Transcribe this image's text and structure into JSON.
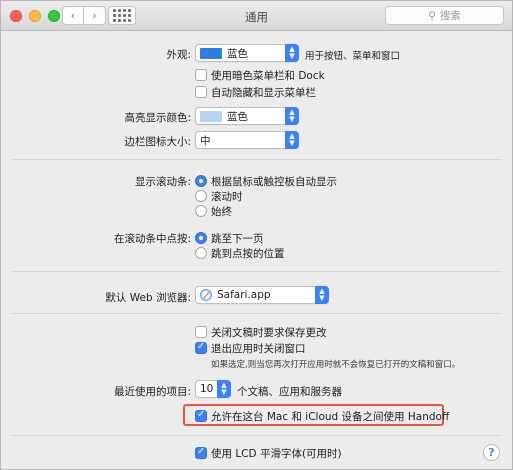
{
  "window": {
    "title": "通用"
  },
  "search": {
    "placeholder": "搜索"
  },
  "appearance": {
    "label": "外观:",
    "value": "蓝色",
    "swatch_color": "#2f7fe3",
    "note": "用于按钮、菜单和窗口",
    "dark_menu": "使用暗色菜单栏和 Dock",
    "auto_hide_menu": "自动隐藏和显示菜单栏"
  },
  "highlight": {
    "label": "高亮显示颜色:",
    "value": "蓝色",
    "swatch_color": "#b5d3f3"
  },
  "sidebar_icon": {
    "label": "边栏图标大小:",
    "value": "中"
  },
  "scrollbars": {
    "label": "显示滚动条:",
    "options": [
      "根据鼠标或触控板自动显示",
      "滚动时",
      "始终"
    ]
  },
  "click_scroll": {
    "label": "在滚动条中点按:",
    "options": [
      "跳至下一页",
      "跳到点按的位置"
    ]
  },
  "browser": {
    "label": "默认 Web 浏览器:",
    "value": "Safari.app"
  },
  "documents": {
    "ask_save": "关闭文稿时要求保存更改",
    "close_windows": "退出应用时关闭窗口",
    "note": "如果选定,则当您再次打开应用时就不会恢复已打开的文稿和窗口。"
  },
  "recent": {
    "label": "最近使用的项目:",
    "value": "10",
    "suffix": "个文稿、应用和服务器"
  },
  "handoff": {
    "label": "允许在这台 Mac 和 iCloud 设备之间使用 Handoff"
  },
  "lcd": {
    "label": "使用 LCD 平滑字体(可用时)"
  },
  "help": {
    "glyph": "?"
  },
  "colors": {
    "accent": "#3b82f7",
    "highlight_border": "#e8553a"
  }
}
